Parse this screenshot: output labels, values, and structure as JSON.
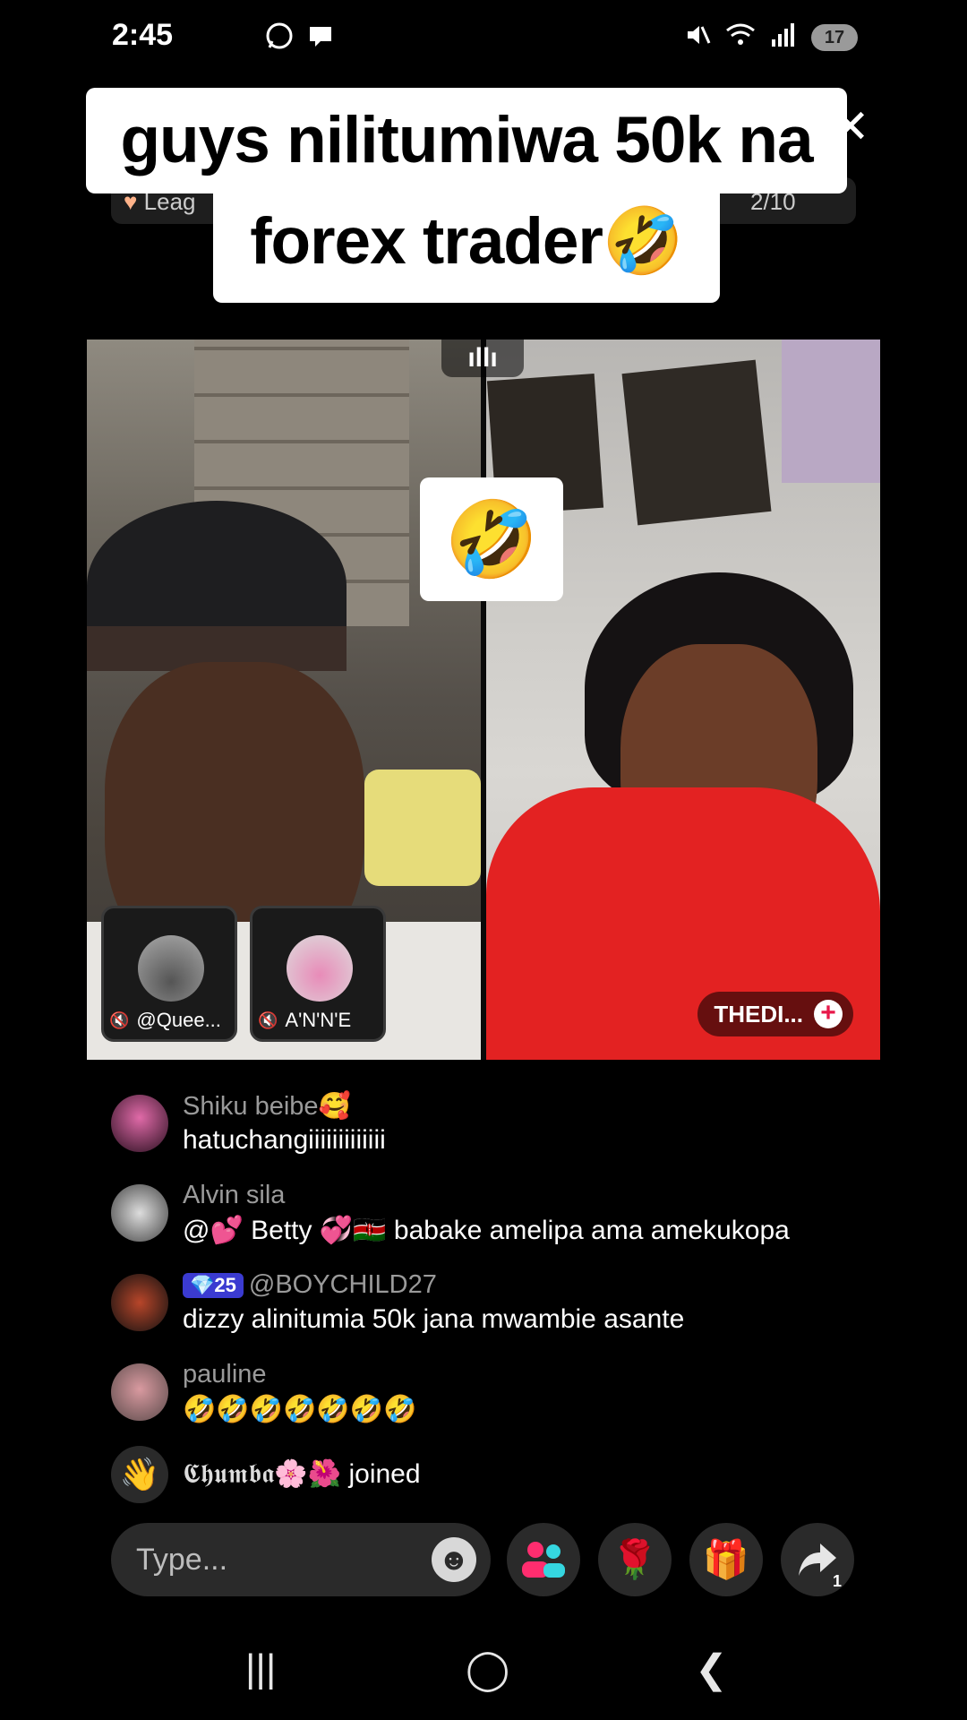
{
  "status_bar": {
    "time": "2:45",
    "battery": "17"
  },
  "caption": {
    "line1": "guys nilitumiwa 50k na",
    "line2": "forex trader🤣"
  },
  "header": {
    "league_label": "Leag",
    "count": "2/10"
  },
  "battle": {
    "live_indicator": "ıllı",
    "center_emoji": "🤣",
    "guests": [
      {
        "name": "@Quee..."
      },
      {
        "name": "A'N'N'E"
      }
    ],
    "opponent_name": "THEDI..."
  },
  "comments": [
    {
      "user": "Shiku beibe🥰",
      "text": "hatuchangiiiiiiiiiiiii"
    },
    {
      "user": "Alvin  sila",
      "text": "@💕 Betty 💞🇰🇪 babake amelipa ama amekukopa"
    },
    {
      "badge": "💎25",
      "user": "@BOYCHILD27",
      "text": "dizzy alinitumia 50k jana mwambie asante"
    },
    {
      "user": "pauline",
      "text": "🤣🤣🤣🤣🤣🤣🤣"
    }
  ],
  "joined": {
    "user": "𝕮𝖍𝖚𝖒𝖇𝖆🌸🌺",
    "action": "joined"
  },
  "input": {
    "placeholder": "Type..."
  },
  "actions": {
    "share_count": "1"
  },
  "colors": {
    "accent_pink": "#ff2d6f",
    "badge_blue": "#3b3bd1"
  }
}
